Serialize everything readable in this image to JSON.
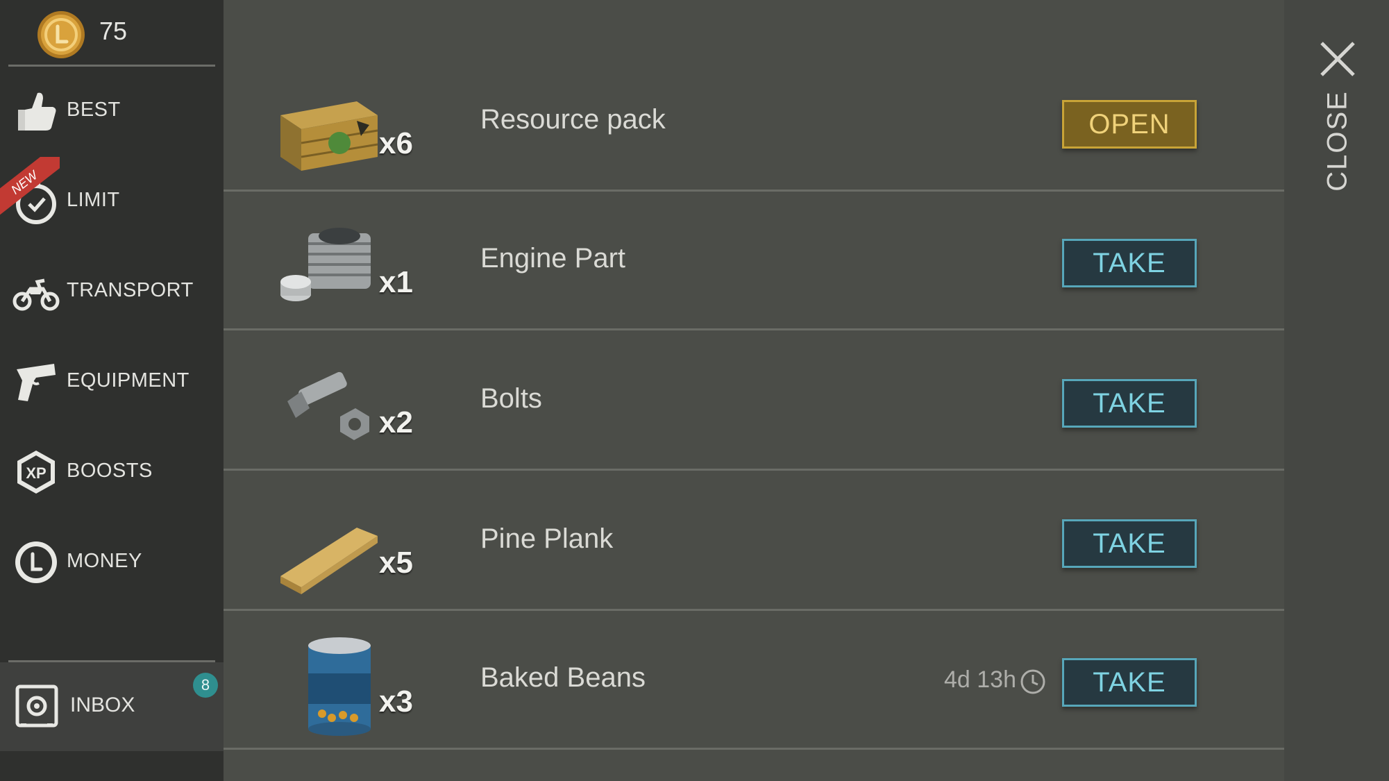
{
  "currency": {
    "icon": "coin-icon",
    "amount": "75"
  },
  "sidebar": {
    "items": [
      {
        "label": "BEST",
        "icon": "thumbs-up-icon"
      },
      {
        "label": "LIMIT",
        "icon": "timer-icon",
        "badge": "NEW"
      },
      {
        "label": "TRANSPORT",
        "icon": "motorcycle-icon"
      },
      {
        "label": "EQUIPMENT",
        "icon": "pistol-icon"
      },
      {
        "label": "BOOSTS",
        "icon": "xp-hexagon-icon"
      },
      {
        "label": "MONEY",
        "icon": "coin-icon"
      }
    ],
    "inbox": {
      "label": "INBOX",
      "icon": "safe-icon",
      "badge": "8"
    }
  },
  "rewards": [
    {
      "name": "Resource pack",
      "qty": "x6",
      "icon": "crate-icon",
      "action": "OPEN"
    },
    {
      "name": "Engine Part",
      "qty": "x1",
      "icon": "engine-part-icon",
      "action": "TAKE"
    },
    {
      "name": "Bolts",
      "qty": "x2",
      "icon": "bolts-icon",
      "action": "TAKE"
    },
    {
      "name": "Pine Plank",
      "qty": "x5",
      "icon": "plank-icon",
      "action": "TAKE"
    },
    {
      "name": "Baked Beans",
      "qty": "x3",
      "icon": "beans-can-icon",
      "action": "TAKE",
      "timer": "4d 13h"
    }
  ],
  "close": {
    "label": "CLOSE",
    "icon": "close-icon"
  },
  "colors": {
    "take_button_border": "#57a7ba",
    "take_button_text": "#7fd3e2",
    "open_button_bg": "#7a6220",
    "new_badge": "#c23a33",
    "inbox_badge": "#2f8f8f"
  }
}
